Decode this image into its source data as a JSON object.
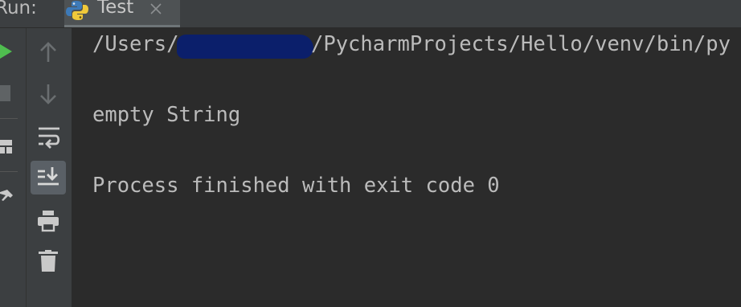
{
  "header": {
    "run_label": "Run:",
    "tab_title": "Test"
  },
  "icons": {
    "run": "play-icon",
    "stop": "stop-icon",
    "layout": "layout-icon",
    "pin": "pin-icon",
    "up": "arrow-up-icon",
    "down": "arrow-down-icon",
    "wrap": "soft-wrap-icon",
    "scroll_end": "scroll-to-end-icon",
    "print": "print-icon",
    "trash": "trash-icon"
  },
  "console": {
    "path_prefix": "/Users/",
    "path_suffix": "/PycharmProjects/Hello/venv/bin/py",
    "output": "empty String",
    "exit_message": "Process finished with exit code 0"
  },
  "colors": {
    "background": "#2b2b2b",
    "panel": "#3c3f41",
    "text": "#bbbbbb",
    "run_green": "#4fbd4f",
    "redaction": "#0b1f6b"
  }
}
